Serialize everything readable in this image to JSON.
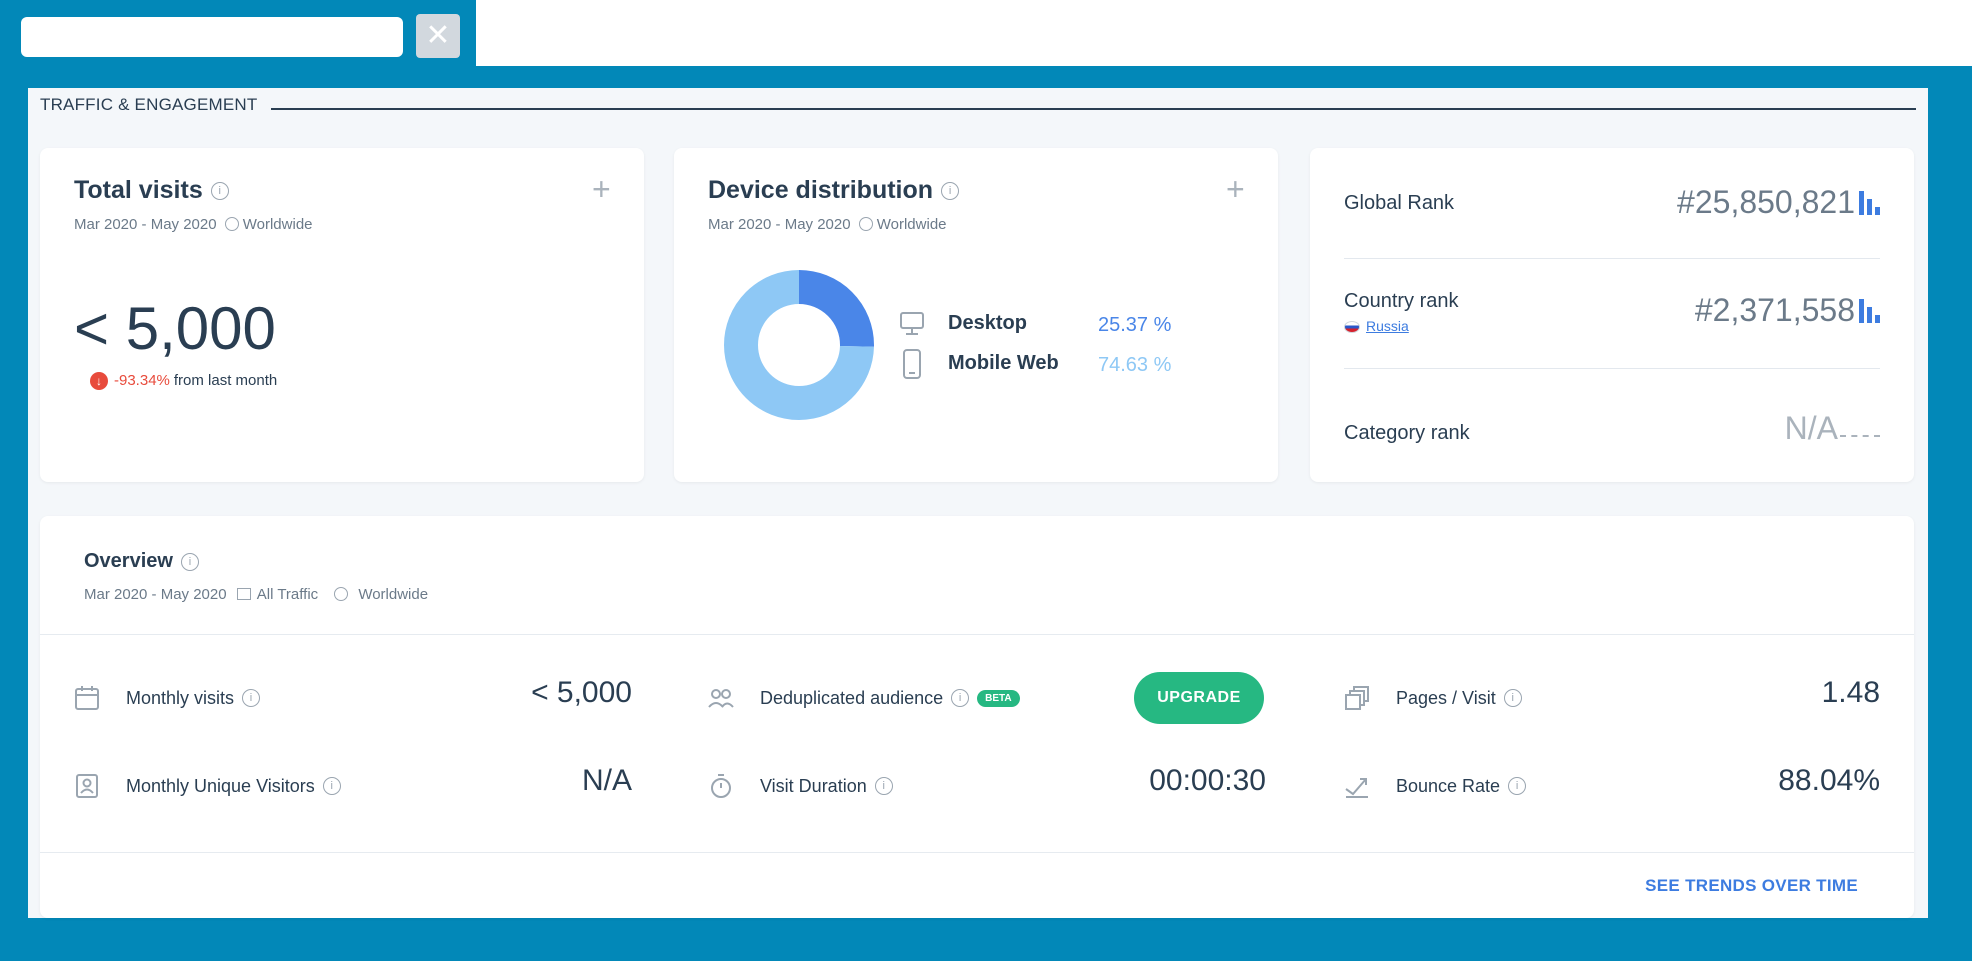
{
  "tab": {
    "close_glyph": "✕"
  },
  "section": {
    "title": "TRAFFIC & ENGAGEMENT"
  },
  "total_visits": {
    "title": "Total visits",
    "date_range": "Mar 2020 - May 2020",
    "region": "Worldwide",
    "value": "< 5,000",
    "change": "-93.34%",
    "change_text": "from last month",
    "change_color": "#e84b3c"
  },
  "device_distribution": {
    "title": "Device distribution",
    "date_range": "Mar 2020 - May 2020",
    "region": "Worldwide",
    "items": [
      {
        "label": "Desktop",
        "value": "25.37 %",
        "percent": 25.37,
        "color": "#4a86e8",
        "icon": "monitor-icon"
      },
      {
        "label": "Mobile Web",
        "value": "74.63 %",
        "percent": 74.63,
        "color": "#8ec8f5",
        "icon": "phone-icon"
      }
    ]
  },
  "ranks": {
    "global": {
      "label": "Global Rank",
      "value": "#25,850,821"
    },
    "country": {
      "label": "Country rank",
      "country": "Russia",
      "value": "#2,371,558"
    },
    "category": {
      "label": "Category rank",
      "value": "N/A"
    },
    "bar_color": "#3d7ce0"
  },
  "overview": {
    "title": "Overview",
    "date_range": "Mar 2020 - May 2020",
    "traffic": "All Traffic",
    "region": "Worldwide",
    "metrics": {
      "monthly_visits": {
        "label": "Monthly visits",
        "value": "< 5,000",
        "icon": "calendar-icon"
      },
      "unique_visitors": {
        "label": "Monthly Unique Visitors",
        "value": "N/A",
        "icon": "id-badge-icon"
      },
      "dedup_audience": {
        "label": "Deduplicated audience",
        "badge": "BETA",
        "button": "UPGRADE",
        "icon": "users-icon"
      },
      "visit_duration": {
        "label": "Visit Duration",
        "value": "00:00:30",
        "icon": "stopwatch-icon"
      },
      "pages_visit": {
        "label": "Pages / Visit",
        "value": "1.48",
        "icon": "pages-icon"
      },
      "bounce_rate": {
        "label": "Bounce Rate",
        "value": "88.04%",
        "icon": "bounce-icon"
      }
    },
    "trends_link": "SEE TRENDS OVER TIME"
  },
  "colors": {
    "accent": "#3d7ce0",
    "upgrade": "#26b882",
    "frame": "#0288b8"
  }
}
